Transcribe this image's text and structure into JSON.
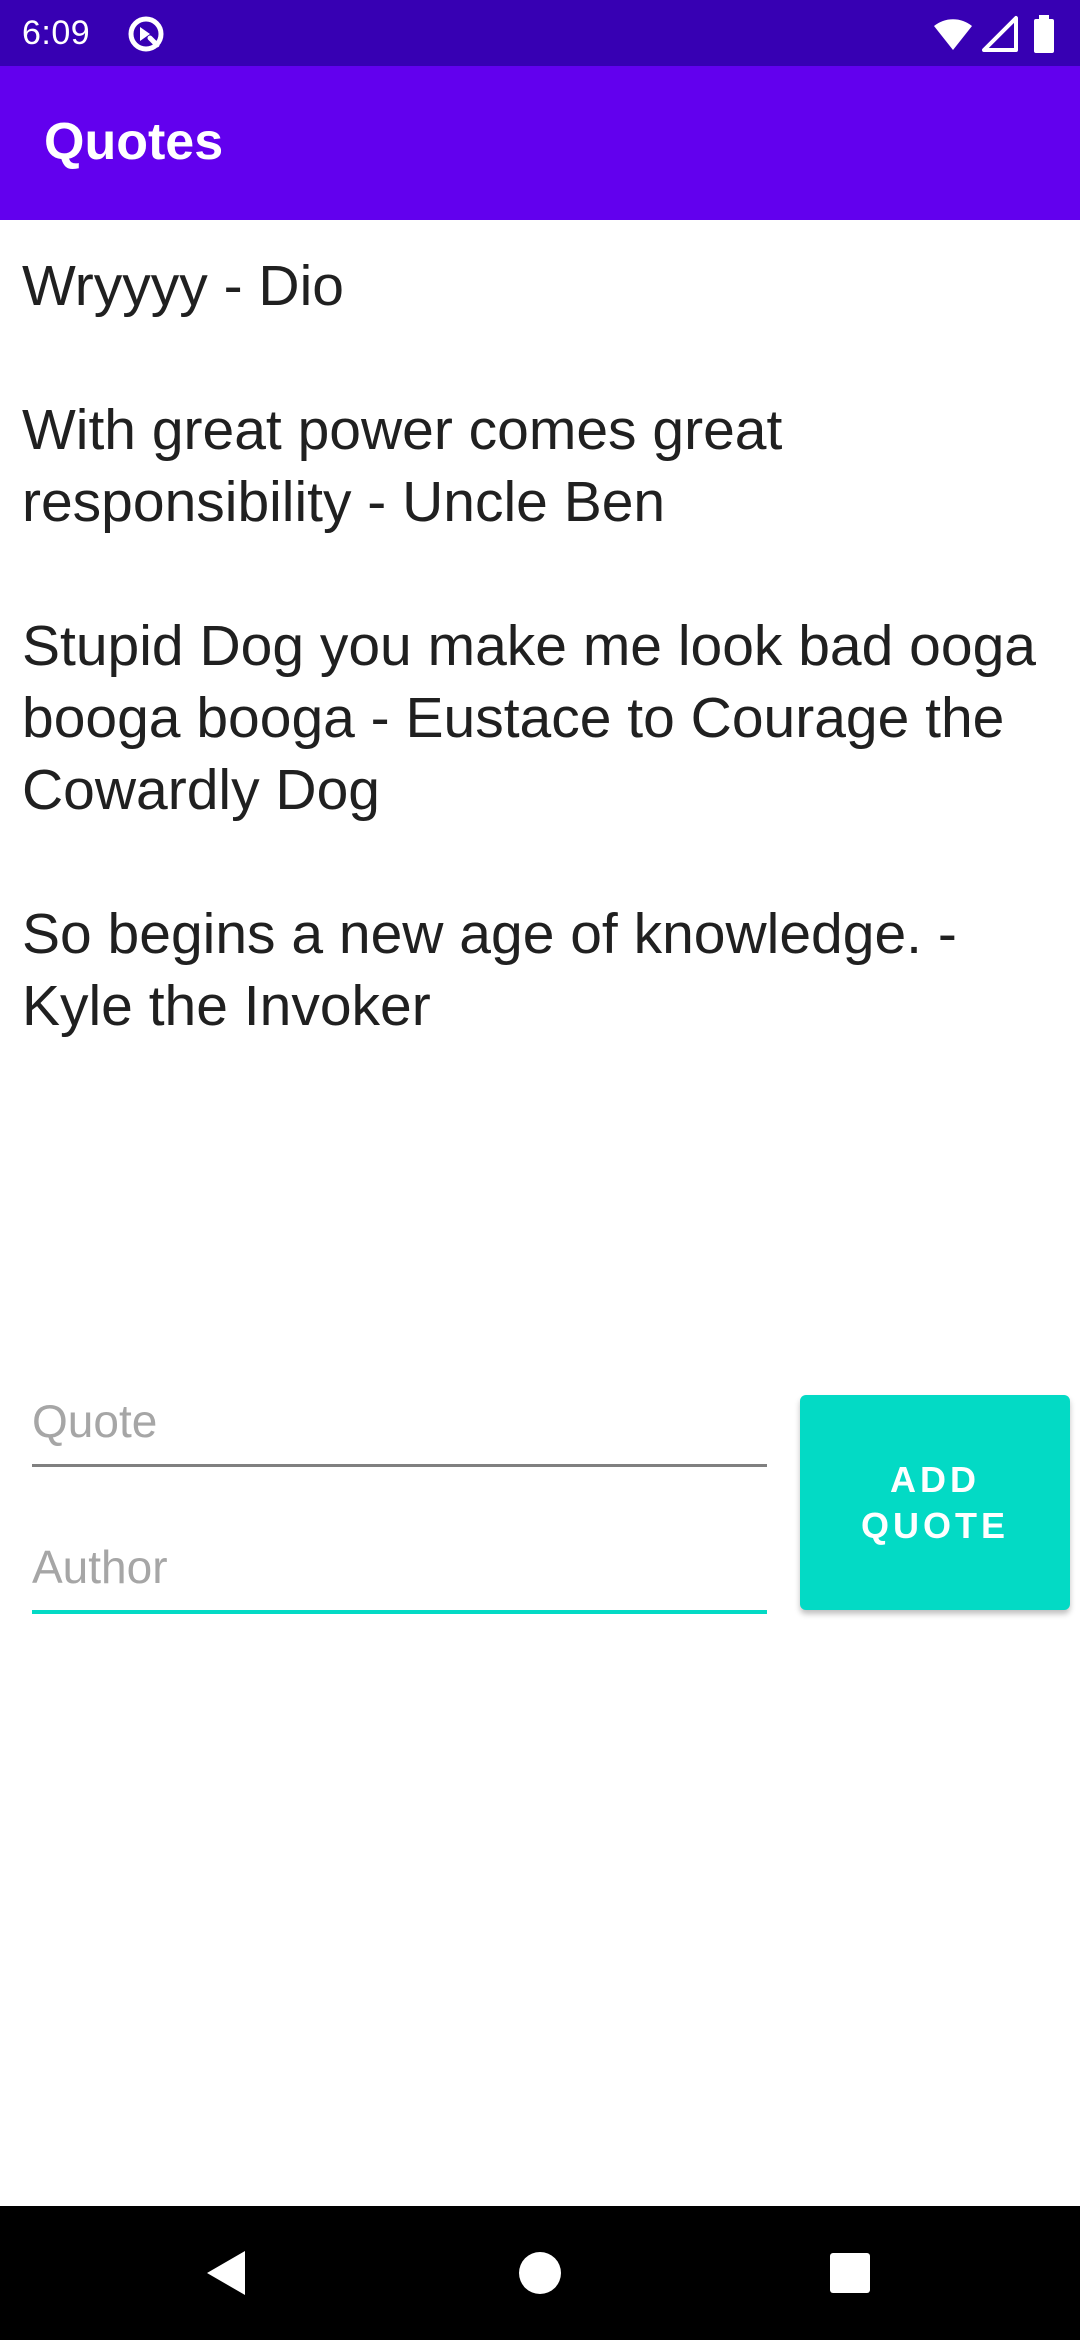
{
  "status_bar": {
    "time": "6:09",
    "icons": [
      "app-notification-icon",
      "wifi-icon",
      "signal-icon",
      "battery-icon"
    ]
  },
  "app_bar": {
    "title": "Quotes"
  },
  "quotes": [
    "Wryyyy - Dio",
    "With great power comes great responsibility - Uncle Ben",
    "Stupid Dog you make me look bad ooga booga booga - Eustace to Courage the Cowardly Dog",
    "So begins a new age of knowledge. - Kyle the Invoker"
  ],
  "form": {
    "quote_placeholder": "Quote",
    "quote_value": "",
    "author_placeholder": "Author",
    "author_value": "",
    "add_button_label": "ADD QUOTE"
  },
  "nav_bar": {
    "icons": [
      "back-icon",
      "home-icon",
      "recents-icon"
    ]
  },
  "colors": {
    "status_bar": "#3700b3",
    "app_bar": "#6200ee",
    "accent": "#03dac5",
    "nav_bar": "#000000"
  }
}
